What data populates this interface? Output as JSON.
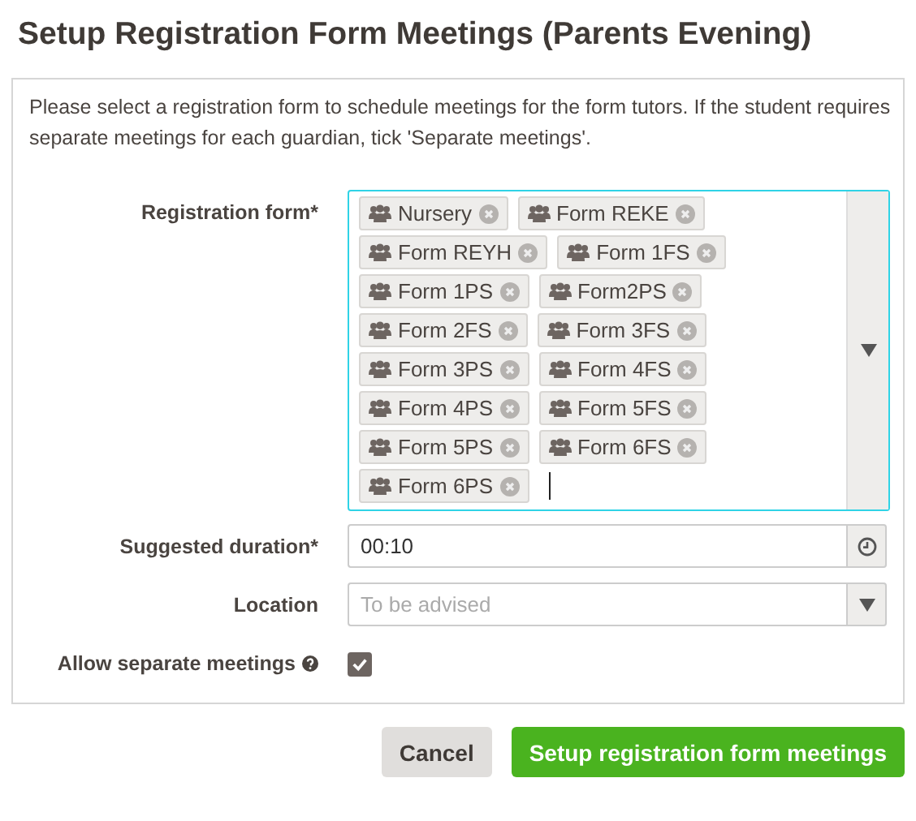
{
  "title": "Setup Registration Form Meetings (Parents Evening)",
  "intro": "Please select a registration form to schedule meetings for the form tutors. If the student requires separate meetings for each guardian, tick 'Separate meetings'.",
  "registration_form": {
    "label": "Registration form*",
    "tags": [
      {
        "label": "Nursery"
      },
      {
        "label": "Form REKE"
      },
      {
        "label": "Form REYH"
      },
      {
        "label": "Form 1FS"
      },
      {
        "label": "Form 1PS"
      },
      {
        "label": "Form2PS"
      },
      {
        "label": "Form 2FS"
      },
      {
        "label": "Form 3FS"
      },
      {
        "label": "Form 3PS"
      },
      {
        "label": "Form 4FS"
      },
      {
        "label": "Form 4PS"
      },
      {
        "label": "Form 5FS"
      },
      {
        "label": "Form 5PS"
      },
      {
        "label": "Form 6FS"
      },
      {
        "label": "Form 6PS"
      }
    ]
  },
  "duration": {
    "label": "Suggested duration*",
    "value": "00:10"
  },
  "location": {
    "label": "Location",
    "placeholder": "To be advised"
  },
  "separate": {
    "label": "Allow separate meetings",
    "checked": true
  },
  "buttons": [
    {
      "label": "Cancel",
      "kind": "secondary"
    },
    {
      "label": "Setup registration form meetings",
      "kind": "primary"
    }
  ]
}
